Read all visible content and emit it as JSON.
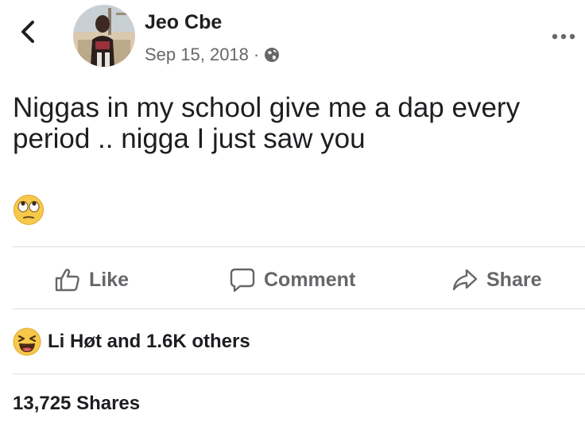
{
  "header": {
    "back_icon": "chevron-left-icon",
    "author_name": "Jeo Cbe",
    "post_date": "Sep 15, 2018",
    "meta_separator": "·",
    "privacy_icon": "globe-icon",
    "more_icon": "ellipsis-icon"
  },
  "post": {
    "text": "Niggas in my school give me a dap every period .. nigga I just saw you",
    "emoji": "face-with-rolling-eyes"
  },
  "actions": {
    "like_label": "Like",
    "comment_label": "Comment",
    "share_label": "Share"
  },
  "reactions": {
    "icon": "haha-reaction-icon",
    "summary": "Li Høt and 1.6K others"
  },
  "shares": {
    "count_text": "13,725 Shares"
  },
  "colors": {
    "text_primary": "#1c1e21",
    "text_secondary": "#65676b",
    "divider": "#dcdde1",
    "emoji_yellow": "#f7c84a"
  }
}
